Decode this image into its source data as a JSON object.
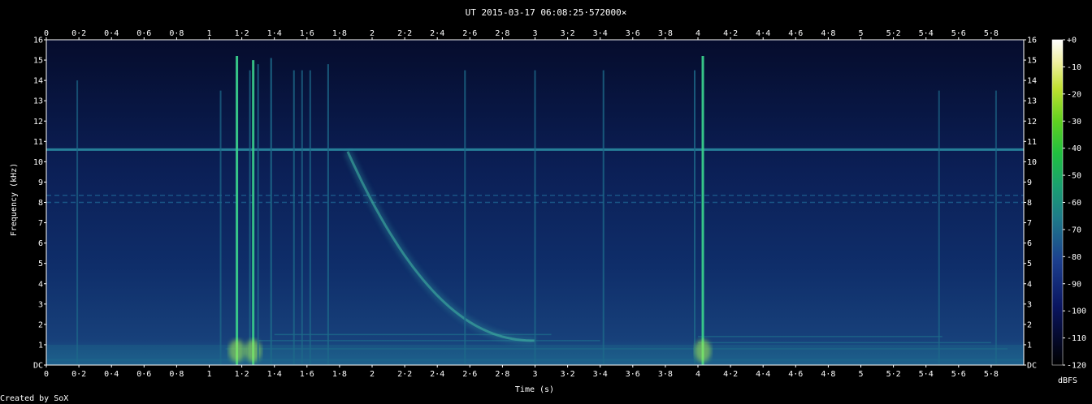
{
  "window": {
    "title": "UT 2015-03-17 06:08:25·572000×",
    "credit": "Created by SoX"
  },
  "chart_data": {
    "type": "heatmap",
    "title": "UT 2015-03-17 06:08:25·572000×",
    "xlabel": "Time (s)",
    "ylabel": "Frequency (kHz)",
    "xlim": [
      0,
      6.0
    ],
    "ylim": [
      0,
      16
    ],
    "x_ticks": [
      "0",
      "0·2",
      "0·4",
      "0·6",
      "0·8",
      "1",
      "1·2",
      "1·4",
      "1·6",
      "1·8",
      "2",
      "2·2",
      "2·4",
      "2·6",
      "2·8",
      "3",
      "3·2",
      "3·4",
      "3·6",
      "3·8",
      "4",
      "4·2",
      "4·4",
      "4·6",
      "4·8",
      "5",
      "5·2",
      "5·4",
      "5·6",
      "5·8"
    ],
    "x_tick_values": [
      0,
      0.2,
      0.4,
      0.6,
      0.8,
      1.0,
      1.2,
      1.4,
      1.6,
      1.8,
      2.0,
      2.2,
      2.4,
      2.6,
      2.8,
      3.0,
      3.2,
      3.4,
      3.6,
      3.8,
      4.0,
      4.2,
      4.4,
      4.6,
      4.8,
      5.0,
      5.2,
      5.4,
      5.6,
      5.8
    ],
    "y_ticks": [
      "DC",
      "1",
      "2",
      "3",
      "4",
      "5",
      "6",
      "7",
      "8",
      "9",
      "10",
      "11",
      "12",
      "13",
      "14",
      "15",
      "16"
    ],
    "colorbar": {
      "label": "dBFS",
      "ticks": [
        "+0",
        "-10",
        "-20",
        "-30",
        "-40",
        "-50",
        "-60",
        "-70",
        "-80",
        "-90",
        "-100",
        "-110",
        "-120"
      ],
      "tick_values": [
        0,
        -10,
        -20,
        -30,
        -40,
        -50,
        -60,
        -70,
        -80,
        -90,
        -100,
        -110,
        -120
      ],
      "range": [
        -120,
        0
      ]
    },
    "colors": {
      "background": "#0b1d55",
      "low": "#0a1440",
      "mid": "#1d6a8a",
      "high": "#38c98a",
      "peak": "#a8f050"
    },
    "features": {
      "carrier_khz": 10.6,
      "band_khz": [
        8.0,
        8.35
      ],
      "sferics": [
        {
          "t": 0.19,
          "f_top": 14.0,
          "level": 0.35
        },
        {
          "t": 1.07,
          "f_top": 13.5,
          "level": 0.45
        },
        {
          "t": 1.17,
          "f_top": 15.2,
          "level": 0.95
        },
        {
          "t": 1.25,
          "f_top": 14.5,
          "level": 0.55
        },
        {
          "t": 1.27,
          "f_top": 15.0,
          "level": 0.85
        },
        {
          "t": 1.3,
          "f_top": 14.8,
          "level": 0.65
        },
        {
          "t": 1.38,
          "f_top": 15.1,
          "level": 0.8
        },
        {
          "t": 1.52,
          "f_top": 14.5,
          "level": 0.55
        },
        {
          "t": 1.57,
          "f_top": 14.5,
          "level": 0.5
        },
        {
          "t": 1.62,
          "f_top": 14.5,
          "level": 0.5
        },
        {
          "t": 1.73,
          "f_top": 14.8,
          "level": 0.6
        },
        {
          "t": 2.57,
          "f_top": 14.5,
          "level": 0.55
        },
        {
          "t": 3.0,
          "f_top": 14.5,
          "level": 0.5
        },
        {
          "t": 3.42,
          "f_top": 14.5,
          "level": 0.55
        },
        {
          "t": 3.98,
          "f_top": 14.5,
          "level": 0.6
        },
        {
          "t": 4.03,
          "f_top": 15.2,
          "level": 0.95
        },
        {
          "t": 5.48,
          "f_top": 13.5,
          "level": 0.35
        },
        {
          "t": 5.83,
          "f_top": 13.5,
          "level": 0.35
        }
      ],
      "whistler": {
        "t_start": 1.85,
        "f_start": 10.5,
        "t_end": 3.0,
        "f_end": 1.2
      },
      "tails": [
        {
          "f": 0.8,
          "t_start": 1.1,
          "t_end": 5.9
        },
        {
          "f": 1.2,
          "t_start": 1.3,
          "t_end": 3.4
        },
        {
          "f": 1.5,
          "t_start": 1.4,
          "t_end": 3.1
        },
        {
          "f": 1.1,
          "t_start": 4.0,
          "t_end": 5.8
        },
        {
          "f": 1.4,
          "t_start": 4.0,
          "t_end": 5.5
        }
      ]
    }
  }
}
